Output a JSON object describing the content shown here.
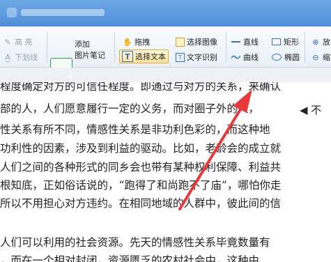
{
  "toolbar": {
    "high_label": "高 亮",
    "underline_label": "下划线",
    "add_note_line1": "添加",
    "add_note_line2": "图片笔记",
    "drag_label": "拖拽",
    "select_text_label": "选择文本",
    "select_image_label": "选择图像",
    "ocr_label": "文字识别",
    "line_label": "直线",
    "curve_label": "曲线",
    "rect_label": "矩形",
    "ellipse_label": "椭圆",
    "zoom_in_label": "放",
    "zoom_out_label": "缩"
  },
  "document": {
    "lines": [
      "程度确定对方的可信任程度。即通过与对方的关系，来确认",
      "部的人，人们愿意履行一定的义务，而对圈子外的人，",
      "性关系有所不同，情感性关系是非功利色彩的，而这种地",
      "功利性的因素，涉及到利益的驱动。比如，老龄会的成立就",
      "人们之间的各种形式的同乡会也带有某种权利保障、利益共",
      "根知底，正如俗话说的，“跑得了和尚跑不了庙”，哪怕你走",
      "所以不用担心对方违约。在相同地域的人群中，彼此间的信",
      "人们可以利用的社会资源。先天的情感性关系毕竟数量有",
      "，而在一个相对封闭，资源匮乏的农村社会中，这种由"
    ],
    "marker": "◀ 不"
  },
  "colors": {
    "accent": "#2f6fc4",
    "arrow": "#e8383d"
  }
}
